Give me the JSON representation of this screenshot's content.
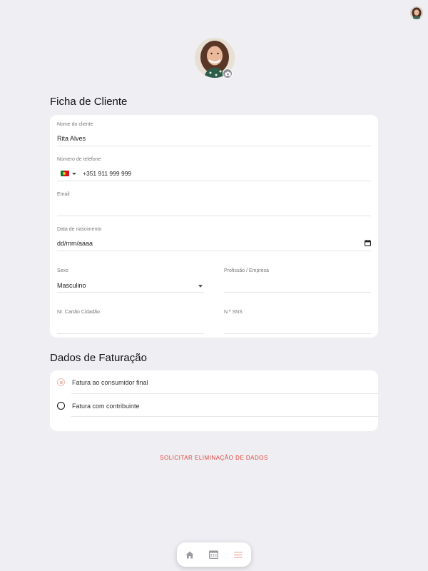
{
  "profile": {
    "top_avatar_icon": "user-avatar",
    "main_avatar_icon": "client-photo",
    "camera_icon": "camera-icon"
  },
  "client_form": {
    "section_title": "Ficha de Cliente",
    "name": {
      "label": "Nome do cliente",
      "value": "Rita Alves"
    },
    "phone": {
      "label": "Número de telefone",
      "country_flag": "PT",
      "value": "+351 911 999 999"
    },
    "email": {
      "label": "Email",
      "value": ""
    },
    "birth_date": {
      "label": "Data de nascimento",
      "placeholder": "dd/mm/aaaa"
    },
    "sex": {
      "label": "Sexo",
      "value": "Masculino"
    },
    "profession": {
      "label": "Profissão / Empresa",
      "value": ""
    },
    "citizen_card": {
      "label": "Nr. Cartão Cidadão",
      "value": ""
    },
    "sns": {
      "label": "N.º SNS",
      "value": ""
    }
  },
  "billing": {
    "section_title": "Dados de Faturação",
    "options": [
      {
        "label": "Fatura ao consumidor final",
        "selected": true
      },
      {
        "label": "Fatura com contribuinte",
        "selected": false
      }
    ]
  },
  "delete_data_label": "SOLICITAR ELIMINAÇÃO DE DADOS",
  "bottom_nav": {
    "items": [
      {
        "icon": "home-icon",
        "active": false
      },
      {
        "icon": "calendar-icon",
        "active": false
      },
      {
        "icon": "menu-icon",
        "active": true
      }
    ]
  },
  "colors": {
    "background": "#efeef3",
    "card": "#ffffff",
    "accent": "#f2b9ad",
    "danger": "#e3443a",
    "nav_inactive": "#9a9aa0"
  }
}
